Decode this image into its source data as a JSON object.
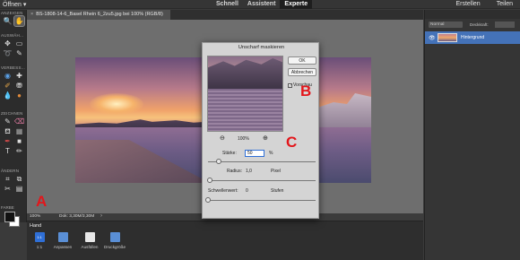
{
  "menu": {
    "open": "Öffnen",
    "open_caret": "▾",
    "create": "Erstellen",
    "share": "Teilen",
    "modes": [
      "Schnell",
      "Assistent",
      "Experte"
    ],
    "active_mode": "Experte"
  },
  "document_tab": {
    "close": "×",
    "title": "BS-1808-14-6_Basel Rhein 6_2zu5.jpg bei 100% (RGB/8)"
  },
  "toolbar": {
    "sections": [
      "ANZEIGEN",
      "AUSWÄH...",
      "VERBESS...",
      "ZEICHNEN",
      "ÄNDERN",
      "FARBE"
    ],
    "tools": [
      {
        "name": "zoom-tool",
        "glyph": "🔍",
        "color": "#dddddd"
      },
      {
        "name": "hand-tool",
        "glyph": "✋",
        "color": "#ffffff"
      },
      {
        "name": "move-tool",
        "glyph": "✥",
        "color": "#dddddd"
      },
      {
        "name": "marquee-tool",
        "glyph": "▭",
        "color": "#dddddd"
      },
      {
        "name": "lasso-tool",
        "glyph": "➰",
        "color": "#dddddd"
      },
      {
        "name": "quick-selection-tool",
        "glyph": "✎",
        "color": "#dddddd"
      },
      {
        "name": "eye-tool",
        "glyph": "◉",
        "color": "#5aa0e6"
      },
      {
        "name": "spot-healing-tool",
        "glyph": "✚",
        "color": "#dddddd"
      },
      {
        "name": "smart-brush-tool",
        "glyph": "✐",
        "color": "#e6a84a"
      },
      {
        "name": "clone-stamp-tool",
        "glyph": "⛃",
        "color": "#dddddd"
      },
      {
        "name": "blur-tool",
        "glyph": "💧",
        "color": "#5aa0e6"
      },
      {
        "name": "sponge-tool",
        "glyph": "●",
        "color": "#e08a3a"
      },
      {
        "name": "brush-tool",
        "glyph": "✎",
        "color": "#dddddd"
      },
      {
        "name": "eraser-tool",
        "glyph": "⌫",
        "color": "#e07aa0"
      },
      {
        "name": "paint-bucket-tool",
        "glyph": "⛾",
        "color": "#dddddd"
      },
      {
        "name": "gradient-tool",
        "glyph": "▦",
        "color": "#aaaaaa"
      },
      {
        "name": "eyedropper-tool",
        "glyph": "✒",
        "color": "#d94a4a"
      },
      {
        "name": "custom-shape-tool",
        "glyph": "■",
        "color": "#dddddd"
      },
      {
        "name": "type-tool",
        "glyph": "T",
        "color": "#dddddd"
      },
      {
        "name": "pencil-tool",
        "glyph": "✏",
        "color": "#dddddd"
      },
      {
        "name": "crop-tool",
        "glyph": "⌗",
        "color": "#dddddd"
      },
      {
        "name": "recompose-tool",
        "glyph": "⧉",
        "color": "#dddddd"
      },
      {
        "name": "content-aware-move-tool",
        "glyph": "✂",
        "color": "#dddddd"
      },
      {
        "name": "straighten-tool",
        "glyph": "▤",
        "color": "#dddddd"
      }
    ]
  },
  "status": {
    "zoom": "100%",
    "doc": "Dok: 3,30M/3,30M",
    "more_arrow": "›"
  },
  "options": {
    "tool_name": "Hand",
    "buttons": [
      {
        "name": "1to1-button",
        "label": "1:1",
        "icon_text": "1:1",
        "color": "#2f6fd6"
      },
      {
        "name": "fit-button",
        "label": "Anpassen",
        "icon_text": "",
        "color": "#5a8fd6"
      },
      {
        "name": "fill-button",
        "label": "Ausfüllen",
        "icon_text": "",
        "color": "#e8e8e8"
      },
      {
        "name": "print-size-button",
        "label": "Druckgröße",
        "icon_text": "",
        "color": "#5a8fd6"
      }
    ]
  },
  "layers_panel": {
    "blend_mode": "Normal",
    "opacity_label": "Deckkraft:",
    "opacity_value": "",
    "eye_icon": "👁",
    "layer_name": "Hintergrund"
  },
  "dialog": {
    "title": "Unscharf maskieren",
    "ok": "OK",
    "cancel": "Abbrechen",
    "preview_label": "Vorschau",
    "preview_checked": true,
    "check_mark": "✓",
    "zoom_out": "⊖",
    "zoom_value": "100%",
    "zoom_in": "⊕",
    "amount_label": "Stärke:",
    "amount_value": "50",
    "amount_unit": "%",
    "amount_fraction": 0.1,
    "radius_label": "Radius:",
    "radius_value": "1,0",
    "radius_unit": "Pixel",
    "radius_fraction": 0.02,
    "threshold_label": "Schwellenwert:",
    "threshold_value": "0",
    "threshold_unit": "Stufen",
    "threshold_fraction": 0.0
  },
  "annotations": [
    "A",
    "B",
    "C"
  ],
  "colors": {
    "accent": "#2f6fd6",
    "annotation_red": "#e3161b",
    "layer_selected": "#4472b8"
  }
}
